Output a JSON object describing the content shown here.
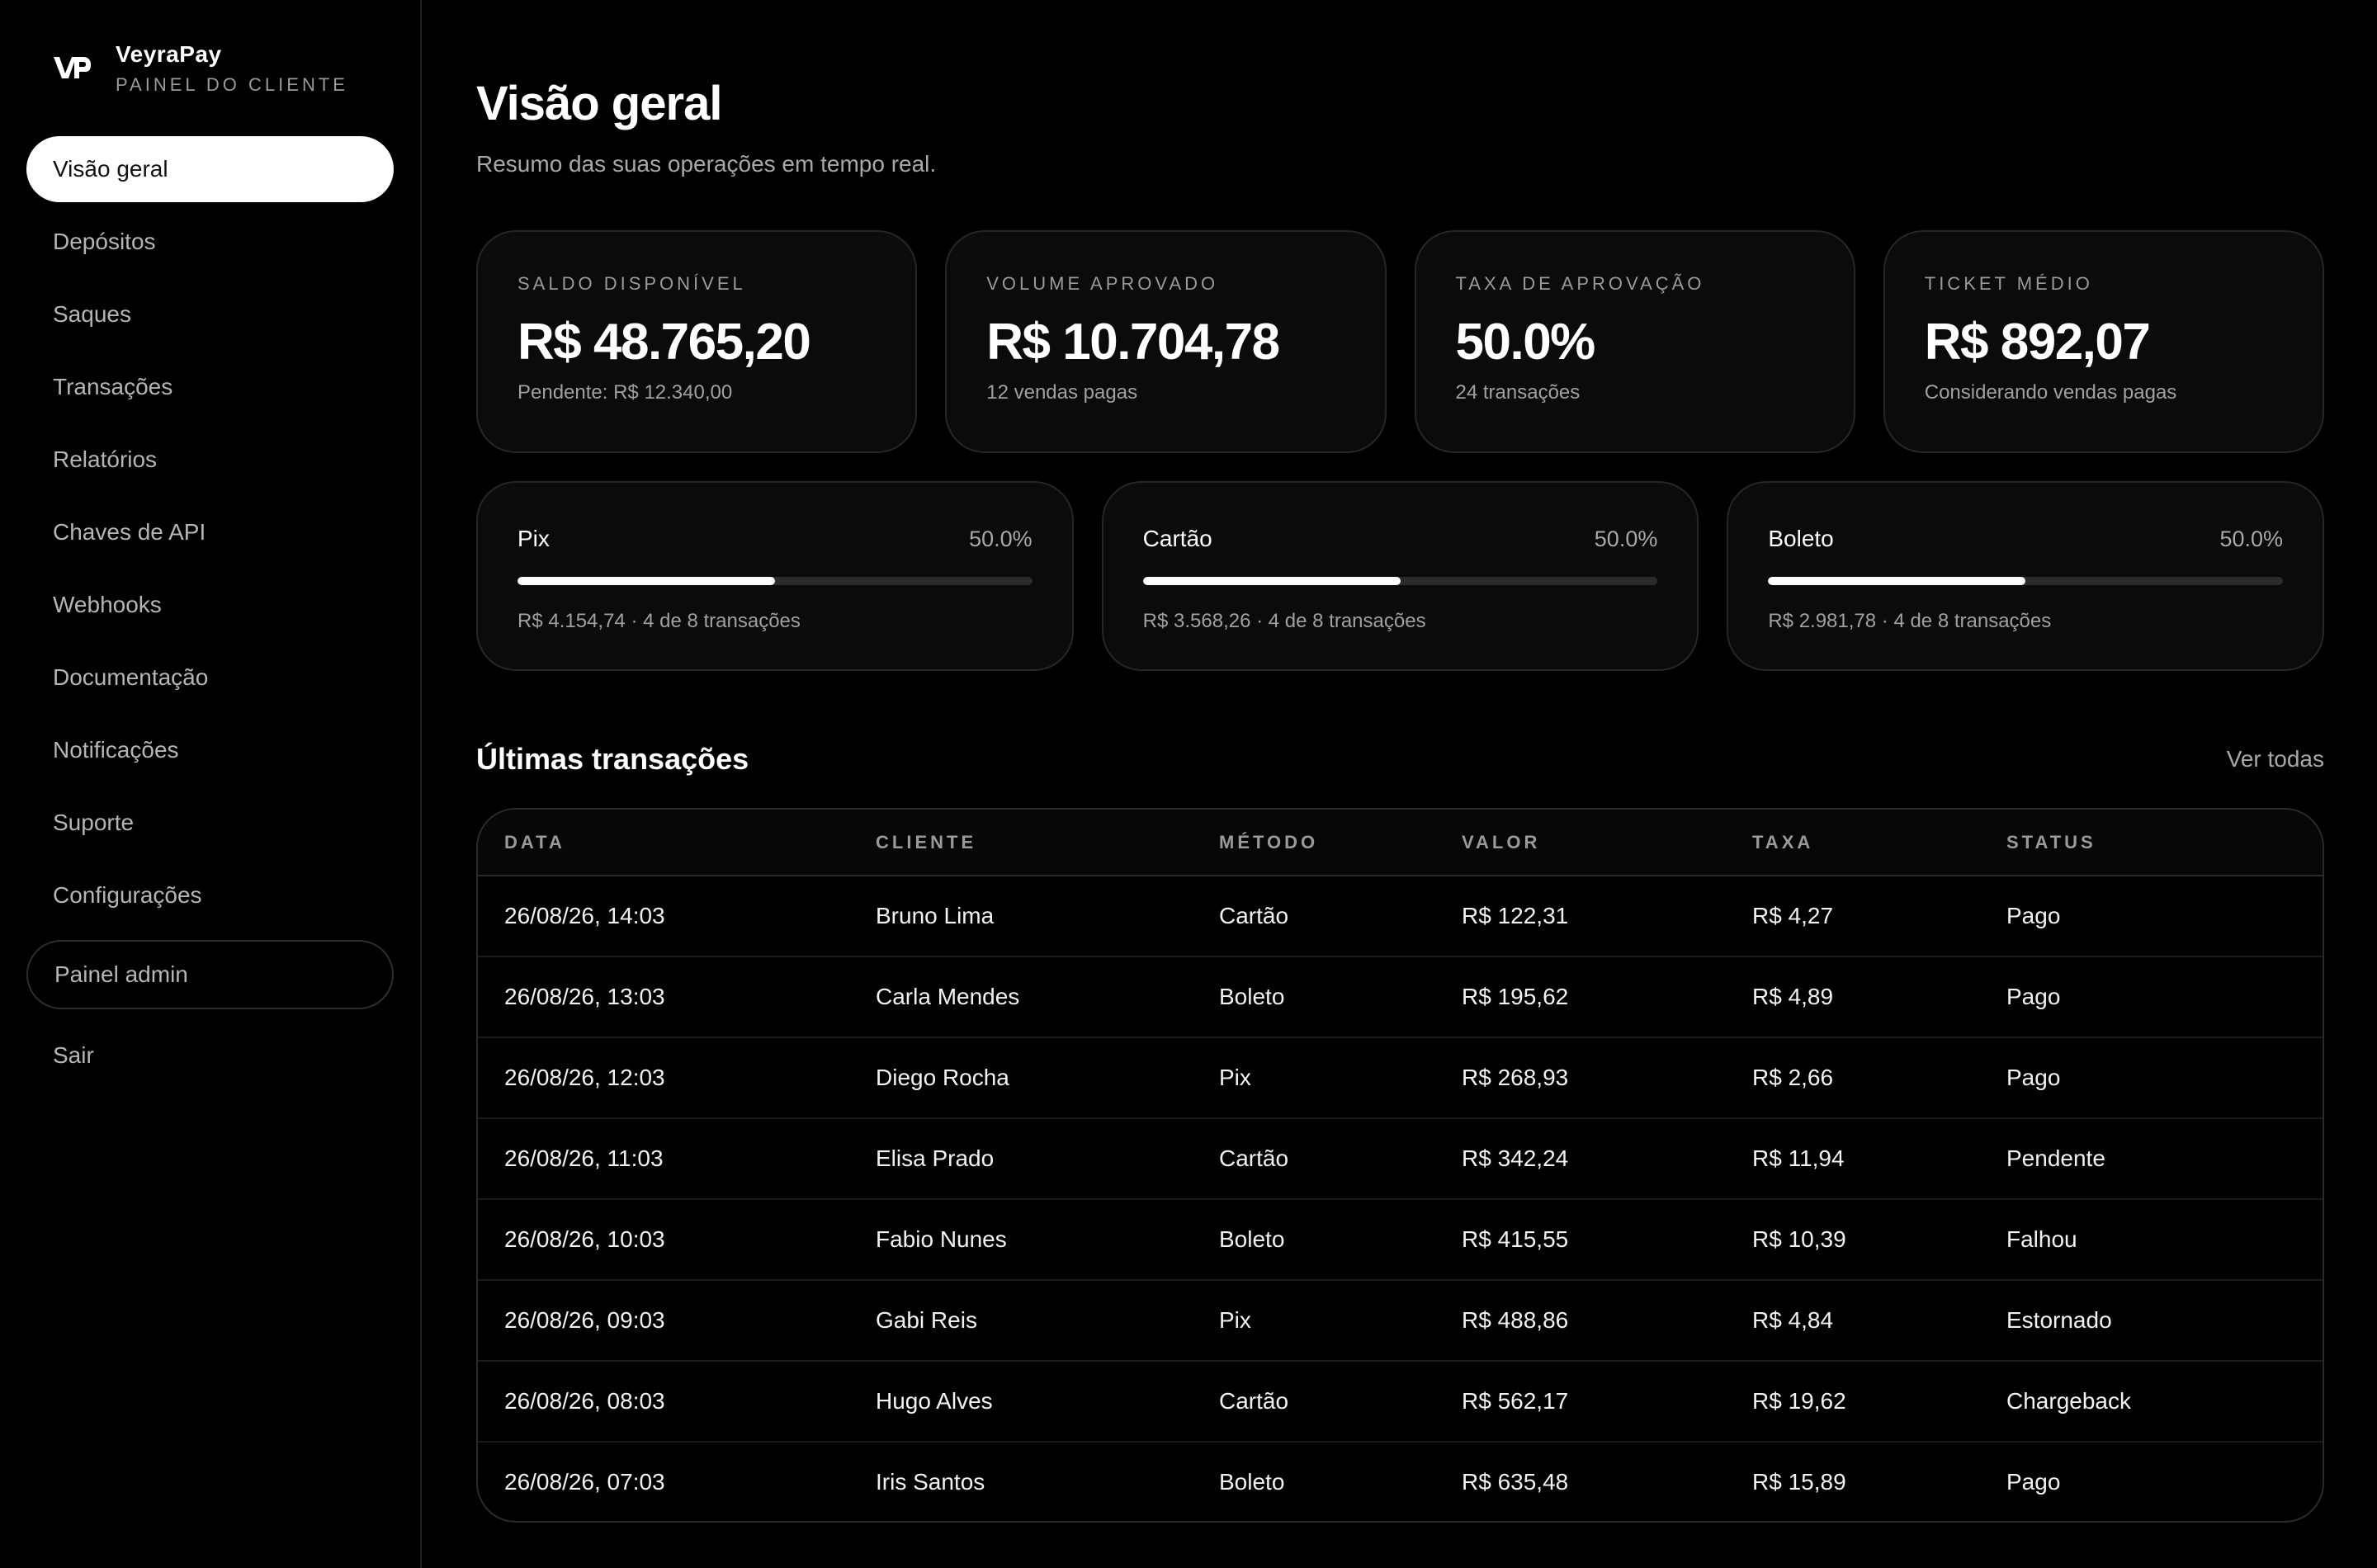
{
  "brand": {
    "name": "VeyraPay",
    "subtitle": "PAINEL DO CLIENTE"
  },
  "sidebar": {
    "items": [
      {
        "label": "Visão geral",
        "active": true
      },
      {
        "label": "Depósitos"
      },
      {
        "label": "Saques"
      },
      {
        "label": "Transações"
      },
      {
        "label": "Relatórios"
      },
      {
        "label": "Chaves de API"
      },
      {
        "label": "Webhooks"
      },
      {
        "label": "Documentação"
      },
      {
        "label": "Notificações"
      },
      {
        "label": "Suporte"
      },
      {
        "label": "Configurações"
      }
    ],
    "admin_label": "Painel admin",
    "logout_label": "Sair"
  },
  "header": {
    "title": "Visão geral",
    "subtitle": "Resumo das suas operações em tempo real."
  },
  "stats": [
    {
      "label": "SALDO DISPONÍVEL",
      "value": "R$ 48.765,20",
      "note": "Pendente: R$ 12.340,00"
    },
    {
      "label": "VOLUME APROVADO",
      "value": "R$ 10.704,78",
      "note": "12 vendas pagas"
    },
    {
      "label": "TAXA DE APROVAÇÃO",
      "value": "50.0%",
      "note": "24 transações"
    },
    {
      "label": "TICKET MÉDIO",
      "value": "R$ 892,07",
      "note": "Considerando vendas pagas"
    }
  ],
  "methods": [
    {
      "name": "Pix",
      "percent": "50.0%",
      "fill": 0.5,
      "note": "R$ 4.154,74 · 4 de 8 transações"
    },
    {
      "name": "Cartão",
      "percent": "50.0%",
      "fill": 0.5,
      "note": "R$ 3.568,26 · 4 de 8 transações"
    },
    {
      "name": "Boleto",
      "percent": "50.0%",
      "fill": 0.5,
      "note": "R$ 2.981,78 · 4 de 8 transações"
    }
  ],
  "transactions": {
    "title": "Últimas transações",
    "view_all": "Ver todas",
    "columns": [
      "DATA",
      "CLIENTE",
      "MÉTODO",
      "VALOR",
      "TAXA",
      "STATUS"
    ],
    "rows": [
      [
        "26/08/26, 14:03",
        "Bruno Lima",
        "Cartão",
        "R$ 122,31",
        "R$ 4,27",
        "Pago"
      ],
      [
        "26/08/26, 13:03",
        "Carla Mendes",
        "Boleto",
        "R$ 195,62",
        "R$ 4,89",
        "Pago"
      ],
      [
        "26/08/26, 12:03",
        "Diego Rocha",
        "Pix",
        "R$ 268,93",
        "R$ 2,66",
        "Pago"
      ],
      [
        "26/08/26, 11:03",
        "Elisa Prado",
        "Cartão",
        "R$ 342,24",
        "R$ 11,94",
        "Pendente"
      ],
      [
        "26/08/26, 10:03",
        "Fabio Nunes",
        "Boleto",
        "R$ 415,55",
        "R$ 10,39",
        "Falhou"
      ],
      [
        "26/08/26, 09:03",
        "Gabi Reis",
        "Pix",
        "R$ 488,86",
        "R$ 4,84",
        "Estornado"
      ],
      [
        "26/08/26, 08:03",
        "Hugo Alves",
        "Cartão",
        "R$ 562,17",
        "R$ 19,62",
        "Chargeback"
      ],
      [
        "26/08/26, 07:03",
        "Iris Santos",
        "Boleto",
        "R$ 635,48",
        "R$ 15,89",
        "Pago"
      ]
    ]
  }
}
